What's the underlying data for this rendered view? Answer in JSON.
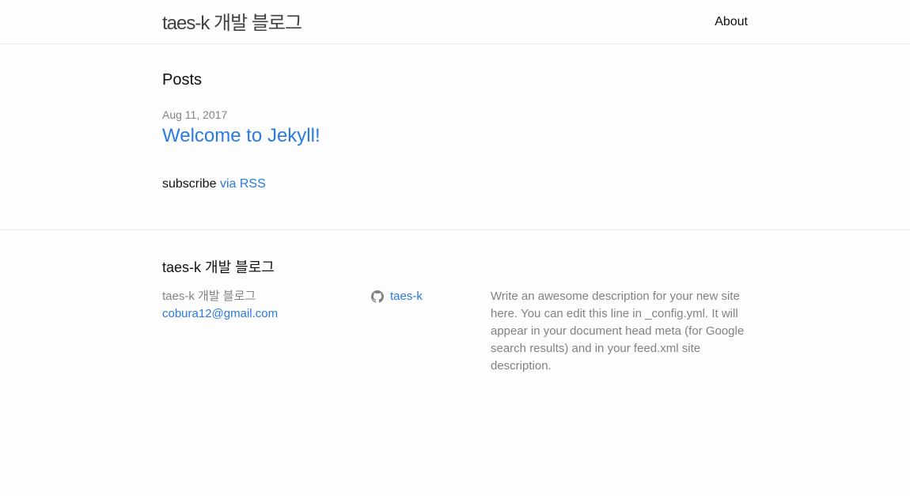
{
  "header": {
    "site_title": "taes-k 개발 블로그",
    "nav": [
      {
        "label": "About"
      }
    ]
  },
  "main": {
    "heading": "Posts",
    "posts": [
      {
        "date": "Aug 11, 2017",
        "title": "Welcome to Jekyll!"
      }
    ],
    "subscribe_text": "subscribe",
    "rss_link": "via RSS"
  },
  "footer": {
    "heading": "taes-k 개발 블로그",
    "col1": {
      "name": "taes-k 개발 블로그",
      "email": "cobura12@gmail.com"
    },
    "col2": {
      "github_icon": "github-icon",
      "github_user": "taes-k"
    },
    "col3": {
      "description": "Write an awesome description for your new site here. You can edit this line in _config.yml. It will appear in your document head meta (for Google search results) and in your feed.xml site description."
    }
  },
  "colors": {
    "link": "#2a7ae2",
    "meta": "#828282",
    "border": "#e8e8e8",
    "background": "#fdfdfd"
  }
}
